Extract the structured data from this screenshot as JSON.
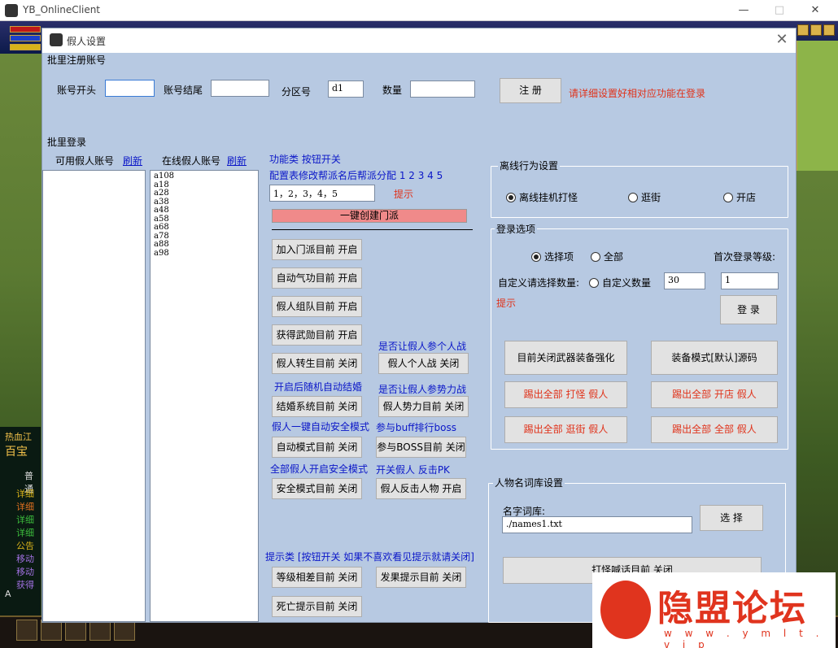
{
  "outer": {
    "title": "YB_OnlineClient",
    "minimize": "—",
    "maximize": "□",
    "close": "✕"
  },
  "hud": {
    "left_lines": [
      "热血江",
      "百宝",
      "普通",
      "详细",
      "详细",
      "详细",
      "详细",
      "公告",
      "移动",
      "移动",
      "获得",
      "A"
    ]
  },
  "dialog": {
    "title": "假人设置",
    "close": "✕",
    "batch_register": {
      "section": "批里注册账号",
      "acct_start": "账号开头",
      "acct_end": "账号结尾",
      "zone": "分区号",
      "zone_value": "d1",
      "count": "数量",
      "register_btn": "注  册",
      "hint": "请详细设置好相对应功能在登录"
    },
    "batch_login": {
      "section": "批里登录",
      "available": "可用假人账号",
      "refresh1": "刷新",
      "online": "在线假人账号",
      "refresh2": "刷新",
      "online_items": [
        "a108",
        "a18",
        "a28",
        "a38",
        "a48",
        "a58",
        "a68",
        "a78",
        "a88",
        "a98"
      ]
    },
    "func": {
      "header": "功能类 按钮开关",
      "config_note": "配置表修改帮派名后帮派分配 1 2 3 4 5",
      "config_value": "1，2，3，4，5",
      "tip": "提示",
      "create_guild": "一键创建门派",
      "join_guild": "加入门派目前 开启",
      "auto_qigong": "自动气功目前 开启",
      "team": "假人组队目前 开启",
      "medal": "获得武勋目前 开启",
      "q_solo": "是否让假人参个人战",
      "rebirth": "假人转生目前 关闭",
      "solo_btn": "假人个人战 关闭",
      "auto_marry_note": "开启后随机自动结婚",
      "q_faction": "是否让假人参势力战",
      "marry": "结婚系统目前 关闭",
      "faction_btn": "假人势力目前 关闭",
      "safe_note": "假人一键自动安全模式",
      "buff_note": "参与buff排行boss",
      "auto_mode": "自动模式目前 关闭",
      "boss_btn": "参与BOSS目前 关闭",
      "all_safe_note": "全部假人开启安全模式",
      "pk_note": "开关假人 反击PK",
      "safe_mode": "安全模式目前 关闭",
      "counter": "假人反击人物 开启",
      "tips_header": "提示类 [按钮开关 如果不喜欢看见提示就请关闭]",
      "level_tip": "等级相差目前 关闭",
      "fruit_tip": "发果提示目前 关闭",
      "death_tip": "死亡提示目前 关闭"
    },
    "offline": {
      "section": "离线行为设置",
      "opt1": "离线挂机打怪",
      "opt2": "逛街",
      "opt3": "开店"
    },
    "login_opts": {
      "section": "登录选项",
      "sel": "选择项",
      "all": "全部",
      "first_level": "首次登录等级:",
      "custom_label": "自定义请选择数量:",
      "custom": "自定义数量",
      "custom_value": "30",
      "level_value": "1",
      "tip": "提示",
      "login_btn": "登 录",
      "weapon_btn": "目前关闭武器装备强化",
      "equip_btn": "装备模式[默认]源码",
      "kick_fight": "踢出全部 打怪 假人",
      "kick_shop": "踢出全部 开店 假人",
      "kick_stroll": "踢出全部 逛街 假人",
      "kick_all": "踢出全部 全部 假人"
    },
    "names": {
      "section": "人物名词库设置",
      "lib_label": "名字词库:",
      "lib_value": "./names1.txt",
      "select_btn": "选 择",
      "speak_btn": "打怪喊话目前 关闭"
    }
  },
  "watermark": {
    "text": "隐盟论坛",
    "url": "w w w . y m l t . v i p"
  }
}
